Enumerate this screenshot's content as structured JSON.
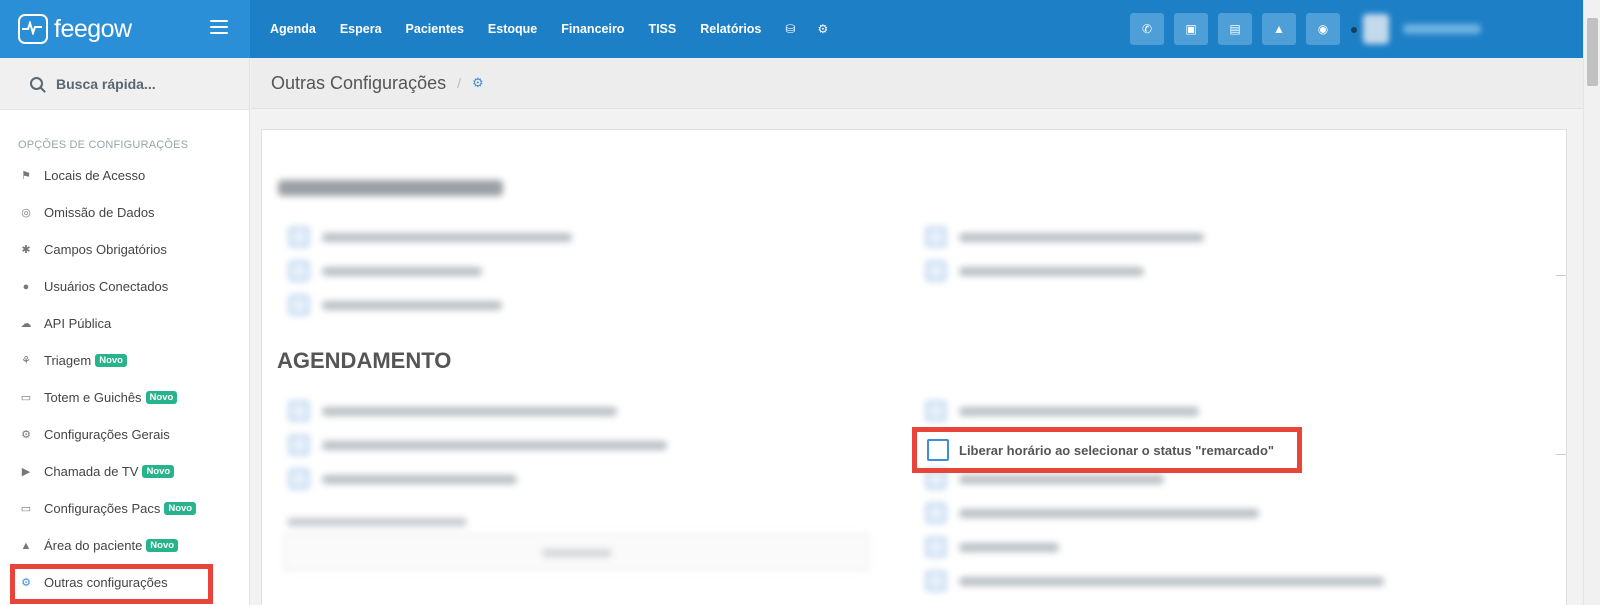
{
  "brand": {
    "name": "feegow"
  },
  "nav": {
    "items": [
      "Agenda",
      "Espera",
      "Pacientes",
      "Estoque",
      "Financeiro",
      "TISS",
      "Relatórios"
    ],
    "icons": [
      "database-icon",
      "gear-icon"
    ]
  },
  "top_actions": [
    "phone-icon",
    "inbox-icon",
    "card-icon",
    "bell-icon",
    "chat-icon"
  ],
  "search": {
    "placeholder": "Busca rápida..."
  },
  "sidebar": {
    "section_label": "OPÇÕES DE CONFIGURAÇÕES",
    "items": [
      {
        "label": "Locais de Acesso",
        "icon": "pin-icon",
        "badge": ""
      },
      {
        "label": "Omissão de Dados",
        "icon": "eye-slash-icon",
        "badge": ""
      },
      {
        "label": "Campos Obrigatórios",
        "icon": "asterisk-icon",
        "badge": ""
      },
      {
        "label": "Usuários Conectados",
        "icon": "user-icon",
        "badge": ""
      },
      {
        "label": "API Pública",
        "icon": "cloud-icon",
        "badge": ""
      },
      {
        "label": "Triagem",
        "icon": "stethoscope-icon",
        "badge": "Novo"
      },
      {
        "label": "Totem e Guichês",
        "icon": "laptop-icon",
        "badge": "Novo"
      },
      {
        "label": "Configurações Gerais",
        "icon": "gears-icon",
        "badge": ""
      },
      {
        "label": "Chamada de TV",
        "icon": "bullhorn-icon",
        "badge": "Novo"
      },
      {
        "label": "Configurações Pacs",
        "icon": "laptop-icon",
        "badge": "Novo"
      },
      {
        "label": "Área do paciente",
        "icon": "flask-icon",
        "badge": "Novo"
      },
      {
        "label": "Outras configurações",
        "icon": "gears-icon",
        "badge": ""
      }
    ]
  },
  "breadcrumb": {
    "title": "Outras Configurações",
    "separator": "/"
  },
  "sections": {
    "agendamento": {
      "heading": "AGENDAMENTO"
    },
    "highlighted_option": {
      "label": "Liberar horário ao selecionar o status \"remarcado\"",
      "checked": false
    }
  },
  "colors": {
    "topbar": "#1d7fc6",
    "highlight": "#e8443a",
    "badge": "#27b38b"
  }
}
